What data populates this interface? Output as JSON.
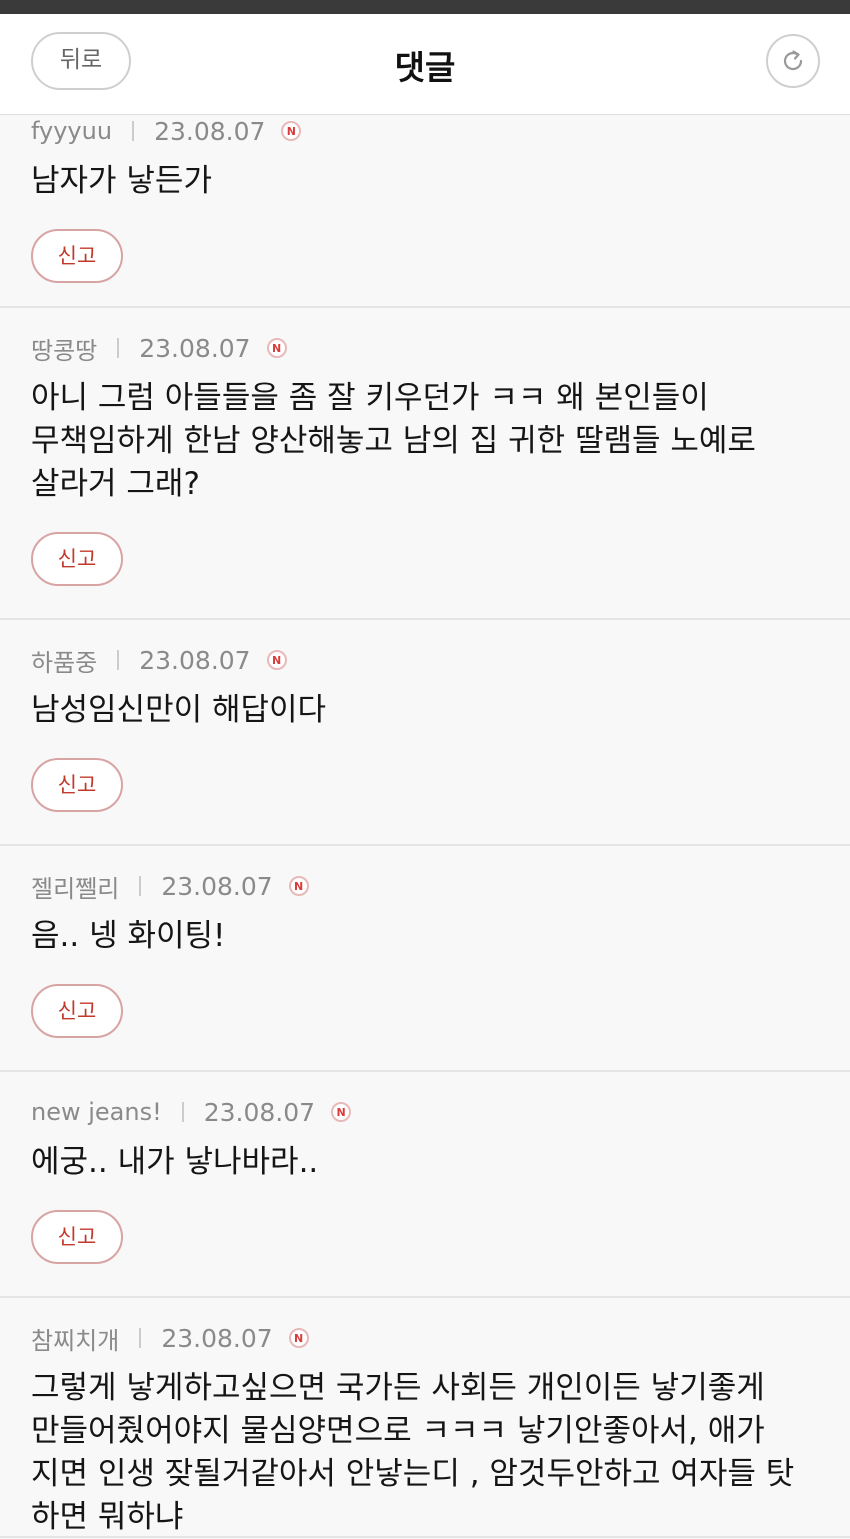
{
  "header": {
    "back_label": "뒤로",
    "title": "댓글",
    "refresh_icon": "refresh-icon"
  },
  "badge_icon": "new-badge-icon",
  "badge_letter": "N",
  "report_label": "신고",
  "colors": {
    "accent_red": "#c0392b",
    "background": "#f8f8f8"
  },
  "comments": [
    {
      "author": "fyyyuu",
      "date": "23.08.07",
      "text": "남자가 낳든가"
    },
    {
      "author": "땅콩땅",
      "date": "23.08.07",
      "text": "아니 그럼 아들들을 좀 잘 키우던가 ㅋㅋ 왜 본인들이 무책임하게 한남 양산해놓고 남의 집 귀한 딸램들 노예로 살라거 그래?"
    },
    {
      "author": "하품중",
      "date": "23.08.07",
      "text": "남성임신만이 해답이다"
    },
    {
      "author": "젤리쩰리",
      "date": "23.08.07",
      "text": "음.. 넹 화이팅!"
    },
    {
      "author": "new jeans!",
      "date": "23.08.07",
      "text": "에궁.. 내가 낳나바라.."
    },
    {
      "author": "참찌치개",
      "date": "23.08.07",
      "text": "그렇게 낳게하고싶으면 국가든 사회든 개인이든 낳기좋게 만들어줬어야지 물심양면으로 ㅋㅋㅋ 낳기안좋아서, 애가 지면 인생 잦될거같아서 안낳는디 , 암것두안하고 여자들 탓 하면 뭐하냐"
    }
  ]
}
